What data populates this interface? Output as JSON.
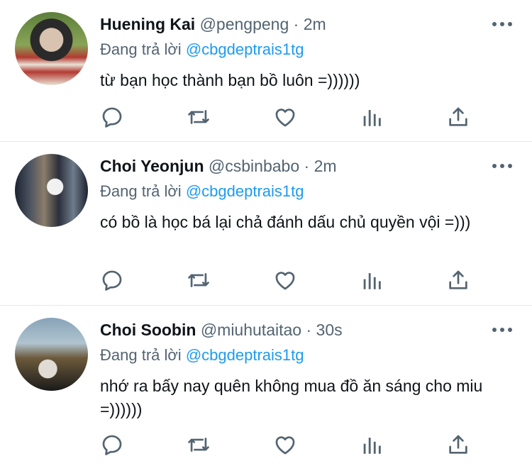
{
  "reply_prefix": "Đang trả lời",
  "colors": {
    "link": "#1d9bf0",
    "muted": "#536471",
    "text": "#0f1419"
  },
  "icons": [
    "reply-icon",
    "retweet-icon",
    "like-icon",
    "stats-icon",
    "share-icon",
    "more-icon"
  ],
  "tweets": [
    {
      "name": "Huening Kai",
      "handle": "@pengpeng",
      "dot": "·",
      "time": "2m",
      "reply_to": "@cbgdeptrais1tg",
      "text": "từ bạn học thành bạn bồ luôn =))))))"
    },
    {
      "name": "Choi Yeonjun",
      "handle": "@csbinbabo",
      "dot": "·",
      "time": "2m",
      "reply_to": "@cbgdeptrais1tg",
      "text": "có bồ là học bá lại chả đánh dấu chủ quyền vội =)))"
    },
    {
      "name": "Choi Soobin",
      "handle": "@miuhutaitao",
      "dot": "·",
      "time": "30s",
      "reply_to": "@cbgdeptrais1tg",
      "text": "nhớ ra bấy nay quên không mua đồ ăn sáng cho miu =))))))"
    }
  ]
}
